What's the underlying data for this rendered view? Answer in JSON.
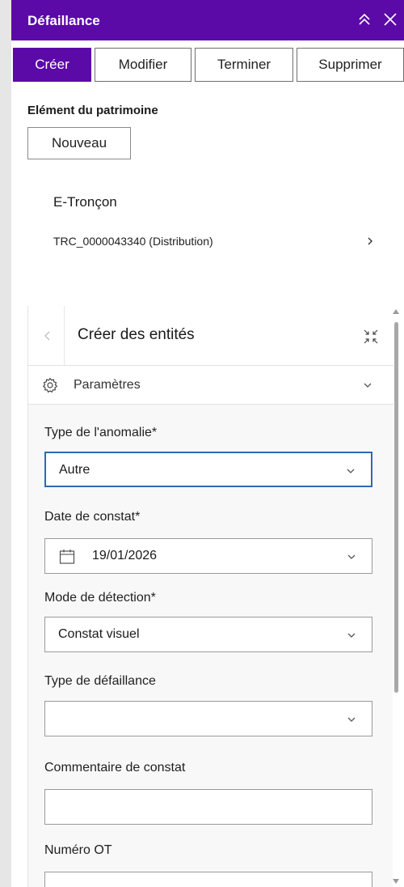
{
  "header": {
    "title": "Défaillance"
  },
  "tabs": [
    {
      "label": "Créer"
    },
    {
      "label": "Modifier"
    },
    {
      "label": "Terminer"
    },
    {
      "label": "Supprimer"
    }
  ],
  "asset": {
    "label": "Elément du patrimoine",
    "new_button": "Nouveau",
    "feature_type": "E-Tronçon",
    "feature_id": "TRC_0000043340 (Distribution)"
  },
  "create_entities": {
    "title": "Créer des entités",
    "settings_label": "Paramètres"
  },
  "form": {
    "anomaly_type": {
      "label": "Type de l'anomalie*",
      "value": "Autre"
    },
    "date": {
      "label": "Date de constat*",
      "value": "19/01/2026"
    },
    "detection_mode": {
      "label": "Mode de détection*",
      "value": "Constat visuel"
    },
    "failure_type": {
      "label": "Type de défaillance",
      "value": ""
    },
    "comment": {
      "label": "Commentaire de constat",
      "value": ""
    },
    "ot_number": {
      "label": "Numéro OT",
      "value": ""
    }
  },
  "colors": {
    "header": "#5b0aa8",
    "focus": "#2e6ab0"
  }
}
